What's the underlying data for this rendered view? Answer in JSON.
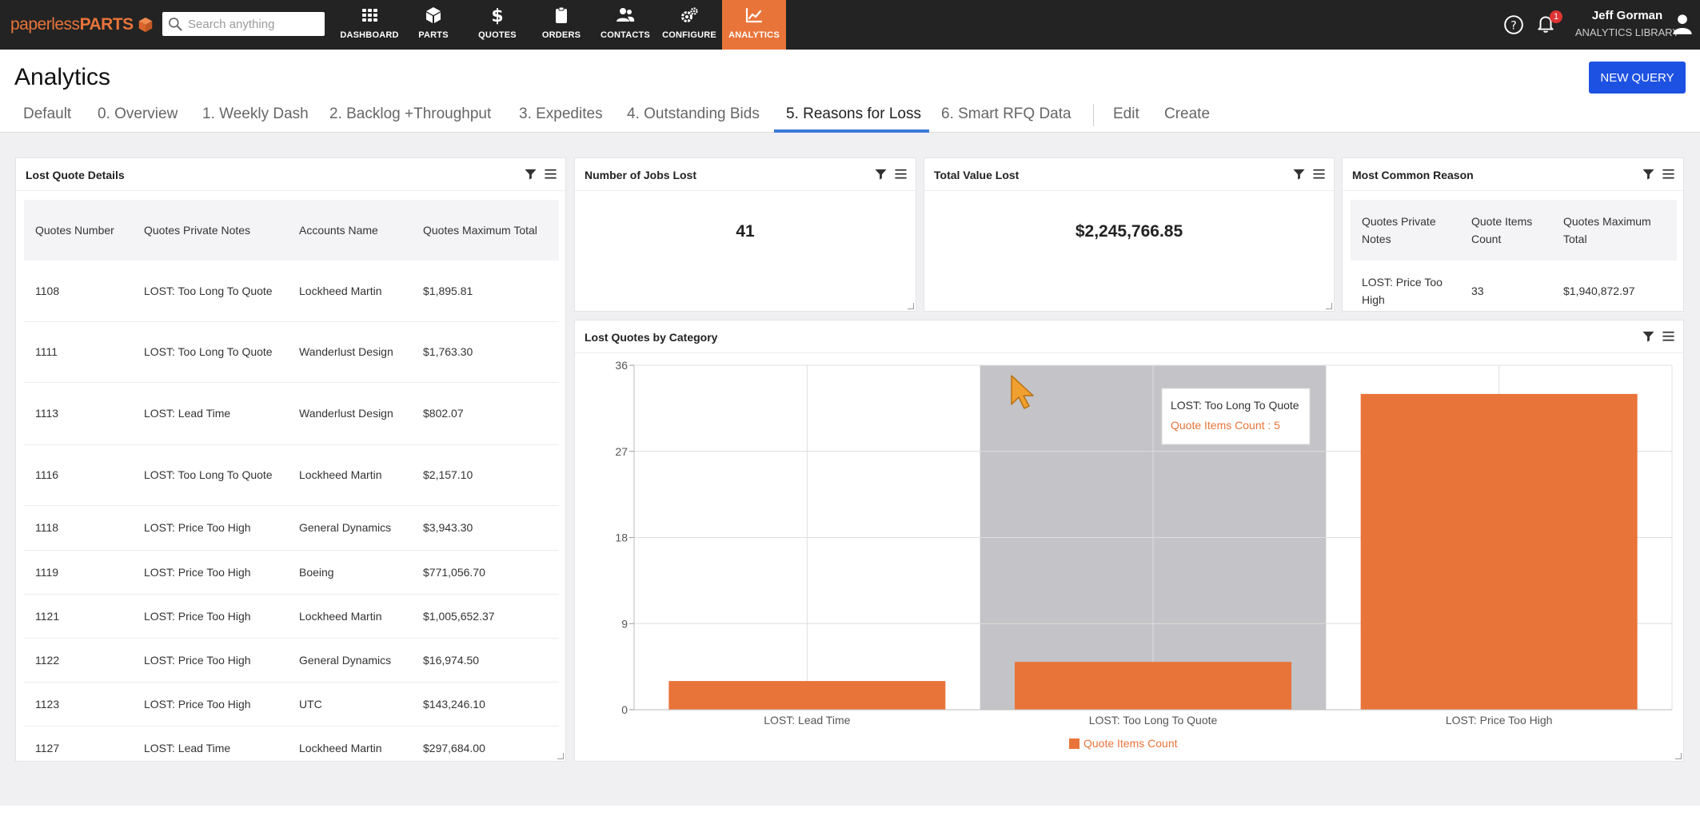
{
  "nav": {
    "logo_a": "paperless",
    "logo_b": "PARTS",
    "search_placeholder": "Search anything",
    "items": [
      {
        "label": "DASHBOARD",
        "icon": "grid-icon"
      },
      {
        "label": "PARTS",
        "icon": "cube-icon"
      },
      {
        "label": "QUOTES",
        "icon": "dollar-icon"
      },
      {
        "label": "ORDERS",
        "icon": "clipboard-icon"
      },
      {
        "label": "CONTACTS",
        "icon": "people-icon"
      },
      {
        "label": "CONFIGURE",
        "icon": "gears-icon"
      },
      {
        "label": "ANALYTICS",
        "icon": "chart-line-icon",
        "active": true
      }
    ],
    "notifications": "1",
    "user_name": "Jeff Gorman",
    "user_role": "ANALYTICS LIBRARY"
  },
  "header": {
    "title": "Analytics",
    "new_query": "NEW QUERY",
    "tabs": [
      "Default",
      "0. Overview",
      "1. Weekly Dash",
      "2. Backlog +Throughput",
      "3. Expedites",
      "4. Outstanding Bids",
      "5. Reasons for Loss",
      "6. Smart RFQ Data",
      "Edit",
      "Create"
    ],
    "active_tab": "5. Reasons for Loss"
  },
  "lost_quotes": {
    "title": "Lost Quote Details",
    "columns": [
      "Quotes Number",
      "Quotes Private Notes",
      "Accounts Name",
      "Quotes Maximum Total"
    ],
    "rows": [
      [
        "1108",
        "LOST: Too Long To Quote",
        "Lockheed Martin",
        "$1,895.81"
      ],
      [
        "1111",
        "LOST: Too Long To Quote",
        "Wanderlust Design",
        "$1,763.30"
      ],
      [
        "1113",
        "LOST: Lead Time",
        "Wanderlust Design",
        "$802.07"
      ],
      [
        "1116",
        "LOST: Too Long To Quote",
        "Lockheed Martin",
        "$2,157.10"
      ],
      [
        "1118",
        "LOST: Price Too High",
        "General Dynamics",
        "$3,943.30"
      ],
      [
        "1119",
        "LOST: Price Too High",
        "Boeing",
        "$771,056.70"
      ],
      [
        "1121",
        "LOST: Price Too High",
        "Lockheed Martin",
        "$1,005,652.37"
      ],
      [
        "1122",
        "LOST: Price Too High",
        "General Dynamics",
        "$16,974.50"
      ],
      [
        "1123",
        "LOST: Price Too High",
        "UTC",
        "$143,246.10"
      ],
      [
        "1127",
        "LOST: Lead Time",
        "Lockheed Martin",
        "$297,684.00"
      ]
    ]
  },
  "jobs_lost": {
    "title": "Number of Jobs Lost",
    "value": "41"
  },
  "value_lost": {
    "title": "Total Value Lost",
    "value": "$2,245,766.85"
  },
  "common_reason": {
    "title": "Most Common Reason",
    "columns": [
      "Quotes Private Notes",
      "Quote Items Count",
      "Quotes Maximum Total"
    ],
    "rows": [
      [
        "LOST: Price Too High",
        "33",
        "$1,940,872.97"
      ]
    ]
  },
  "category_chart": {
    "title": "Lost Quotes by Category",
    "tooltip_title": "LOST: Too Long To Quote",
    "tooltip_value": "Quote Items Count : 5"
  },
  "chart_data": {
    "type": "bar",
    "categories": [
      "LOST: Lead Time",
      "LOST: Too Long To Quote",
      "LOST: Price Too High"
    ],
    "series": [
      {
        "name": "Quote Items Count",
        "values": [
          3,
          5,
          33
        ],
        "color": "#e8743a"
      }
    ],
    "ylim": [
      0,
      36
    ],
    "yticks": [
      "0",
      "9",
      "18",
      "27",
      "36"
    ],
    "highlighted_category": "LOST: Too Long To Quote",
    "grid": true,
    "legend": "bottom"
  },
  "colors": {
    "accent": "#e8743a",
    "primary_button": "#1d51e2",
    "nav_bg": "#232323"
  }
}
